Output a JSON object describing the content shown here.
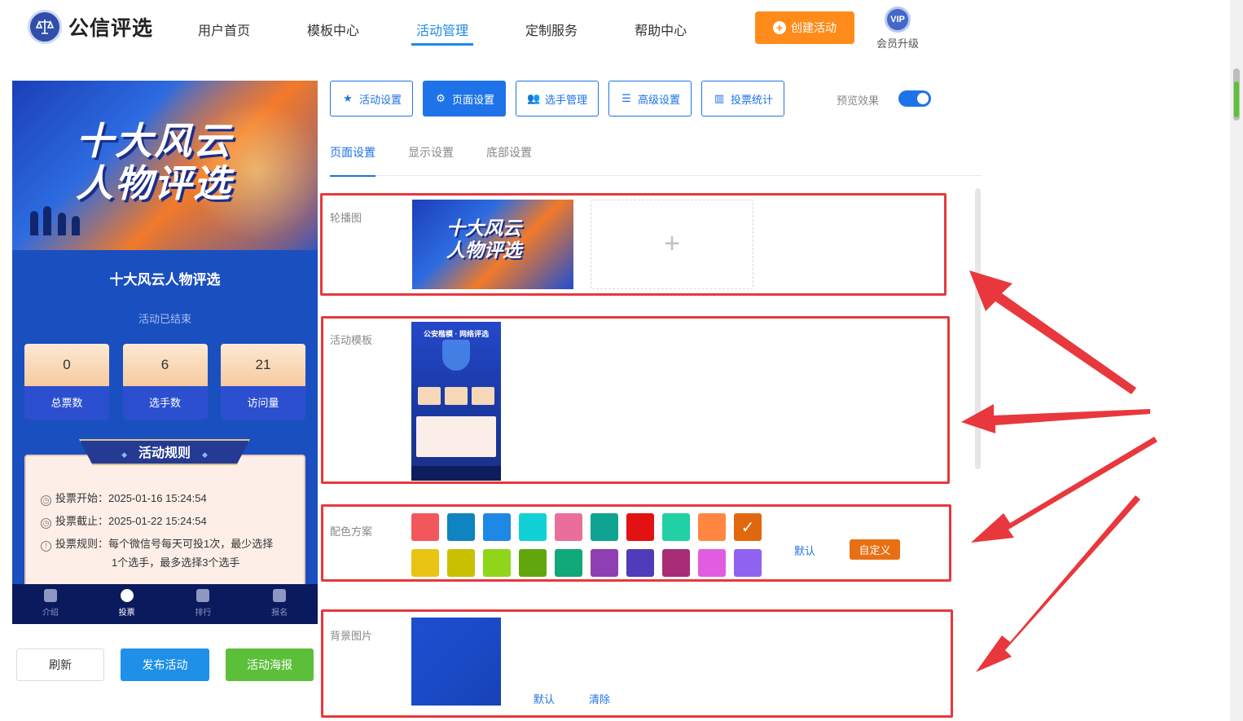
{
  "header": {
    "brand": "公信评选",
    "nav": [
      {
        "label": "用户首页",
        "active": false
      },
      {
        "label": "模板中心",
        "active": false
      },
      {
        "label": "活动管理",
        "active": true
      },
      {
        "label": "定制服务",
        "active": false
      },
      {
        "label": "帮助中心",
        "active": false
      }
    ],
    "create_label": "创建活动",
    "vip_badge": "VIP",
    "vip_label": "会员升级"
  },
  "preview": {
    "banner_line1": "十大风云",
    "banner_line2": "人物评选",
    "title": "十大风云人物评选",
    "status": "活动已结束",
    "stats": [
      {
        "value": "0",
        "label": "总票数"
      },
      {
        "value": "6",
        "label": "选手数"
      },
      {
        "value": "21",
        "label": "访问量"
      }
    ],
    "rules_title": "活动规则",
    "rules": {
      "start": "投票开始：2025-01-16 15:24:54",
      "end": "投票截止：2025-01-22 15:24:54",
      "rule": "投票规则：每个微信号每天可投1次，最少选择",
      "rule2": "1个选手，最多选择3个选手"
    },
    "tabs": [
      {
        "label": "介绍",
        "active": false
      },
      {
        "label": "投票",
        "active": true
      },
      {
        "label": "排行",
        "active": false
      },
      {
        "label": "报名",
        "active": false
      }
    ]
  },
  "actions": {
    "refresh": "刷新",
    "publish": "发布活动",
    "poster": "活动海报"
  },
  "toolbar": {
    "buttons": [
      {
        "label": "活动设置",
        "icon": "star-icon",
        "active": false
      },
      {
        "label": "页面设置",
        "icon": "gear-icon",
        "active": true
      },
      {
        "label": "选手管理",
        "icon": "users-icon",
        "active": false
      },
      {
        "label": "高级设置",
        "icon": "sliders-icon",
        "active": false
      },
      {
        "label": "投票统计",
        "icon": "bar-chart-icon",
        "active": false
      }
    ],
    "preview_label": "预览效果",
    "preview_on": true
  },
  "subtabs": [
    {
      "label": "页面设置",
      "active": true
    },
    {
      "label": "显示设置",
      "active": false
    },
    {
      "label": "底部设置",
      "active": false
    }
  ],
  "sections": {
    "carousel": {
      "label": "轮播图",
      "image_line1": "十大风云",
      "image_line2": "人物评选",
      "add_symbol": "+"
    },
    "template": {
      "label": "活动模板",
      "thumb_title": "公安楷模 · 网络评选"
    },
    "colors": {
      "label": "配色方案",
      "palette": [
        "#f2585b",
        "#0e84c0",
        "#1e88e5",
        "#12d1d6",
        "#e96f9a",
        "#0fa392",
        "#e31212",
        "#21d0a5",
        "#ff8742",
        "#e0690f",
        "#eac413",
        "#c8c000",
        "#8fd61a",
        "#61a60c",
        "#11a87a",
        "#8e3fb3",
        "#4f3cb8",
        "#a82d76",
        "#e05de0",
        "#9062f0"
      ],
      "selected_index": 9,
      "default_label": "默认",
      "custom_label": "自定义"
    },
    "background": {
      "label": "背景图片",
      "default_label": "默认",
      "clear_label": "清除"
    }
  },
  "colors": {
    "accent": "#1e73e8",
    "highlight": "#e8383d",
    "orange": "#ff8c1a",
    "green": "#5cbf3a"
  }
}
